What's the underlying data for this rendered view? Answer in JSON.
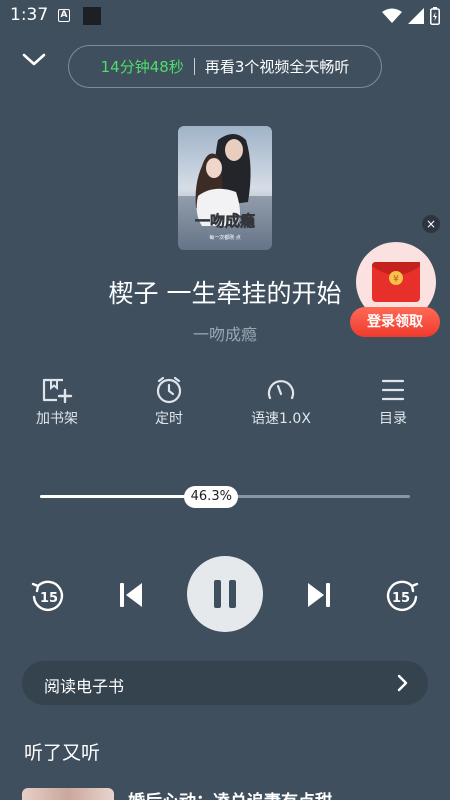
{
  "status_bar": {
    "time": "1:37",
    "notif_letter": "A"
  },
  "header": {
    "pill_time": "14分钟48秒",
    "pill_text": "再看3个视频全天畅听"
  },
  "cover": {
    "title_text": "一吻成瘾",
    "small_text": "每一次都刚 点"
  },
  "promo": {
    "close": "×",
    "label": "登录领取",
    "coin": "¥"
  },
  "track": {
    "title": "楔子 一生牵挂的开始",
    "book": "一吻成瘾"
  },
  "actions": [
    {
      "label": "加书架",
      "icon": "add-bookshelf-icon"
    },
    {
      "label": "定时",
      "icon": "timer-icon"
    },
    {
      "label": "语速1.0X",
      "icon": "speed-gauge-icon"
    },
    {
      "label": "目录",
      "icon": "list-icon"
    }
  ],
  "progress": {
    "label": "46.3%",
    "value": 0.463
  },
  "controls": {
    "rewind_seconds": "15",
    "forward_seconds": "15"
  },
  "ebook": {
    "label": "阅读电子书"
  },
  "section": {
    "title": "听了又听"
  },
  "recommendation": {
    "title": "婚后心动：凌总追妻有点甜"
  },
  "colors": {
    "background": "#3f4f5e",
    "accent_green": "#4ede6a",
    "promo_red": "#f03a2e"
  }
}
